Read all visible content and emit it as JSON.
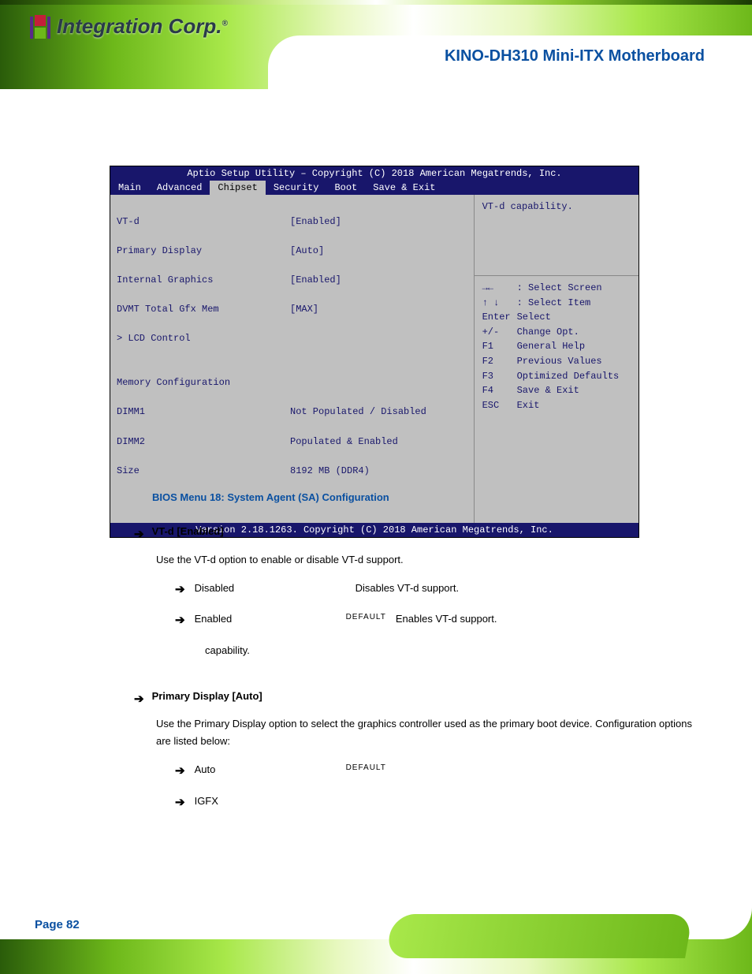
{
  "header": {
    "brand": "Integration Corp.",
    "doc_title": "KINO-DH310 Mini-ITX Motherboard"
  },
  "bios": {
    "title": "Aptio Setup Utility – Copyright (C) 2018 American Megatrends, Inc.",
    "footer": "Version 2.18.1263. Copyright (C) 2018 American Megatrends, Inc.",
    "tabs": [
      "Main",
      "Advanced",
      "Chipset",
      "Security",
      "Boot",
      "Save & Exit"
    ],
    "active_tab": "Chipset",
    "left": {
      "items": [
        {
          "label": "VT-d",
          "value": "[Enabled]"
        },
        {
          "label": "Primary Display",
          "value": "[Auto]"
        },
        {
          "label": "Internal Graphics",
          "value": "[Enabled]"
        },
        {
          "label": "DVMT Total Gfx Mem",
          "value": "[MAX]"
        }
      ],
      "submenus": [
        "> LCD Control"
      ],
      "sections": [
        {
          "heading": "Memory Configuration",
          "lines": [
            {
              "label": "DIMM1",
              "value": "Not Populated / Disabled"
            },
            {
              "label": "DIMM2",
              "value": "Populated & Enabled"
            },
            {
              "label": "Size",
              "value": "8192 MB (DDR4)"
            }
          ]
        }
      ]
    },
    "right": {
      "hint": "VT-d capability.",
      "keys": [
        {
          "k": "→←",
          "d": ": Select Screen"
        },
        {
          "k": "↑ ↓",
          "d": ": Select Item"
        },
        {
          "k": "Enter",
          "d": "Select"
        },
        {
          "k": "+/-",
          "d": "Change Opt."
        },
        {
          "k": "F1",
          "d": "General Help"
        },
        {
          "k": "F2",
          "d": "Previous Values"
        },
        {
          "k": "F3",
          "d": "Optimized Defaults"
        },
        {
          "k": "F4",
          "d": "Save & Exit"
        },
        {
          "k": "ESC",
          "d": "Exit"
        }
      ]
    }
  },
  "caption": "BIOS Menu 18: System Agent (SA) Configuration",
  "opt1": {
    "title": "VT-d [Enabled]",
    "desc": "Use the VT-d option to enable or disable VT-d support.",
    "choices": [
      {
        "label": "Disabled",
        "def": "",
        "text": "Disables VT-d support."
      },
      {
        "label": "Enabled",
        "def": "DEFAULT",
        "text": "Enables VT-d support."
      }
    ],
    "choice_sublabel": "capability."
  },
  "opt2": {
    "title": "Primary Display [Auto]",
    "desc": "Use the Primary Display option to select the graphics controller used as the primary boot device. Configuration options are listed below:",
    "choices": [
      {
        "label": "Auto",
        "def": "DEFAULT"
      },
      {
        "label": "IGFX",
        "def": ""
      }
    ]
  },
  "page_number": "Page 82"
}
